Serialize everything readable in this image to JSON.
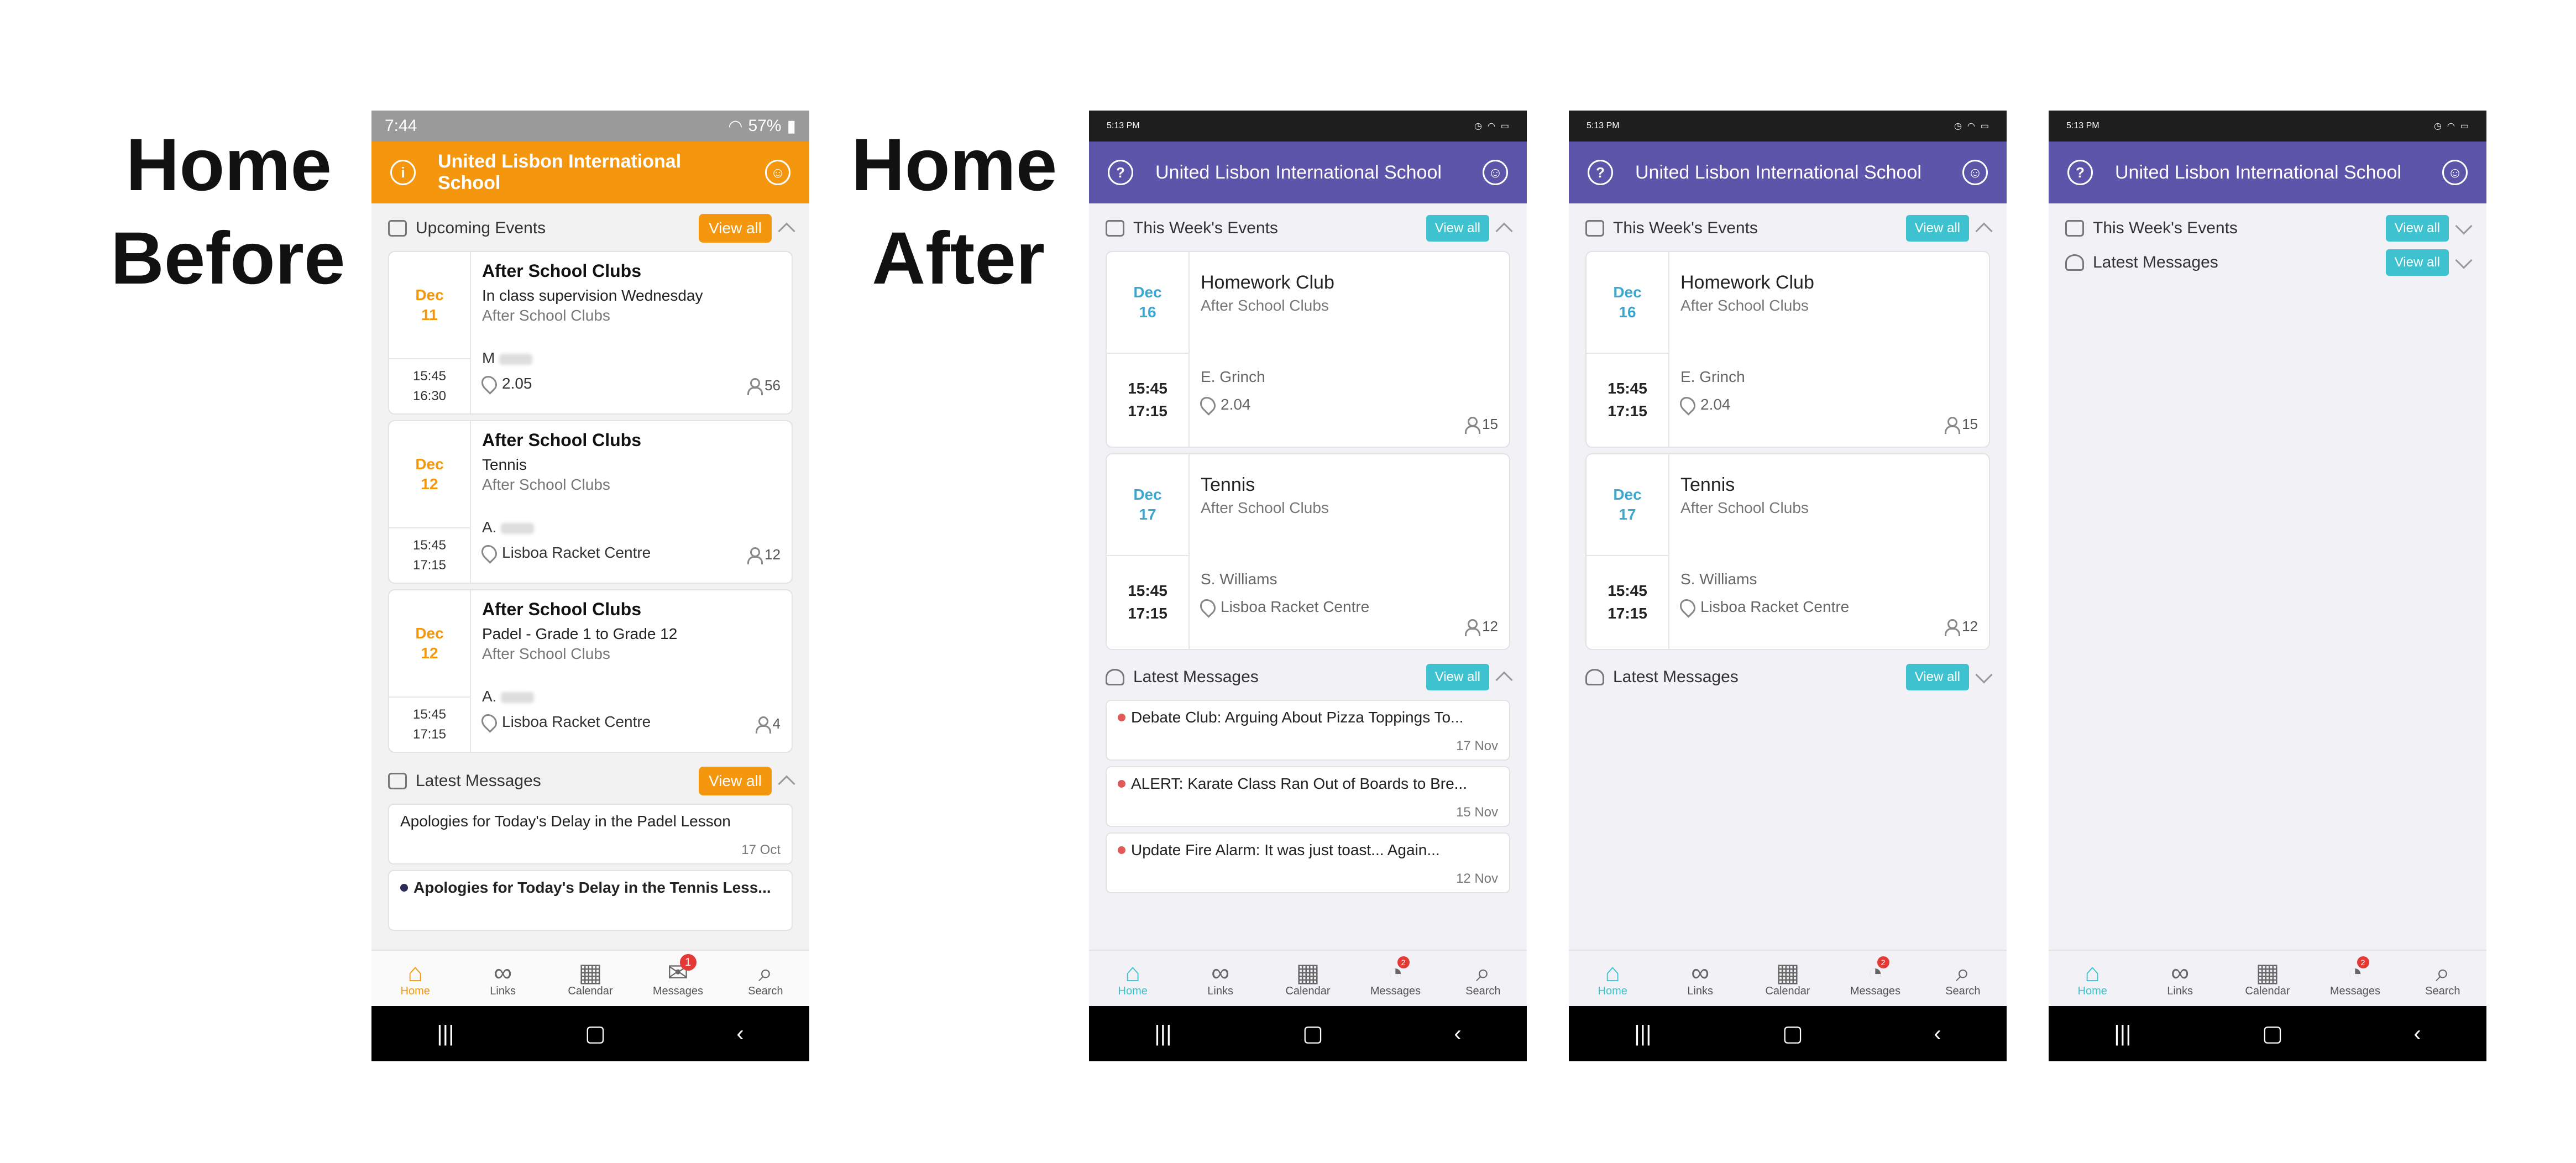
{
  "labels": {
    "before_line1": "Home",
    "before_line2": "Before",
    "after_line1": "Home",
    "after_line2": "After"
  },
  "before": {
    "status": {
      "time": "7:44",
      "battery": "57%"
    },
    "header_title": "United Lisbon International School",
    "events_title": "Upcoming Events",
    "view_all": "View all",
    "events": [
      {
        "month": "Dec",
        "day": "11",
        "start": "15:45",
        "end": "16:30",
        "title": "After School Clubs",
        "sub": "In class supervision Wednesday",
        "category": "After School Clubs",
        "teacher": "M",
        "location": "2.05",
        "count": "56"
      },
      {
        "month": "Dec",
        "day": "12",
        "start": "15:45",
        "end": "17:15",
        "title": "After School Clubs",
        "sub": "Tennis",
        "category": "After School Clubs",
        "teacher": "A.",
        "location": "Lisboa Racket Centre",
        "count": "12"
      },
      {
        "month": "Dec",
        "day": "12",
        "start": "15:45",
        "end": "17:15",
        "title": "After School Clubs",
        "sub": "Padel - Grade 1 to Grade 12",
        "category": "After School Clubs",
        "teacher": "A.",
        "location": "Lisboa Racket Centre",
        "count": "4"
      }
    ],
    "messages_title": "Latest Messages",
    "messages": [
      {
        "text": "Apologies for Today's Delay in the Padel Lesson",
        "date": "17 Oct"
      },
      {
        "text": "Apologies for Today's Delay in the Tennis Less..."
      }
    ],
    "tabs": [
      {
        "label": "Home",
        "icon": "home-icon"
      },
      {
        "label": "Links",
        "icon": "link-icon"
      },
      {
        "label": "Calendar",
        "icon": "calendar-icon"
      },
      {
        "label": "Messages",
        "icon": "mail-icon",
        "badge": "1"
      },
      {
        "label": "Search",
        "icon": "search-icon"
      }
    ]
  },
  "after": {
    "status_time": "5:13 PM",
    "header_title": "United Lisbon International School",
    "events_title": "This Week's Events",
    "messages_title": "Latest Messages",
    "view_all": "View all",
    "events": [
      {
        "month": "Dec",
        "day": "16",
        "start": "15:45",
        "end": "17:15",
        "title": "Homework Club",
        "category": "After School Clubs",
        "teacher": "E. Grinch",
        "location": "2.04",
        "count": "15"
      },
      {
        "month": "Dec",
        "day": "17",
        "start": "15:45",
        "end": "17:15",
        "title": "Tennis",
        "category": "After School Clubs",
        "teacher": "S. Williams",
        "location": "Lisboa Racket Centre",
        "count": "12"
      }
    ],
    "messages": [
      {
        "text": "Debate Club: Arguing About Pizza Toppings To...",
        "date": "17 Nov"
      },
      {
        "text": "ALERT: Karate Class Ran Out of Boards to Bre...",
        "date": "15 Nov"
      },
      {
        "text": "Update Fire Alarm: It was just toast... Again...",
        "date": "12 Nov"
      }
    ],
    "tabs": [
      {
        "label": "Home",
        "icon": "home-icon"
      },
      {
        "label": "Links",
        "icon": "link-icon"
      },
      {
        "label": "Calendar",
        "icon": "calendar-icon"
      },
      {
        "label": "Messages",
        "icon": "chat-icon",
        "badge": "2"
      },
      {
        "label": "Search",
        "icon": "search-icon"
      }
    ]
  },
  "colors": {
    "before_accent": "#f5960f",
    "after_header": "#5d55aa",
    "after_accent": "#3ec2cf"
  }
}
